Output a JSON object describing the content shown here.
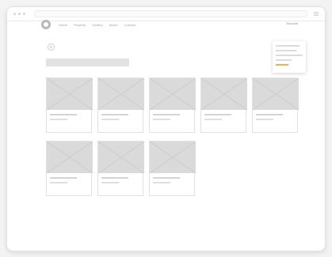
{
  "header": {
    "menu": [
      {
        "label": "Home"
      },
      {
        "label": "Projects"
      },
      {
        "label": "Gallery"
      },
      {
        "label": "About"
      },
      {
        "label": "Contact"
      }
    ],
    "account_label": "Account"
  },
  "page": {
    "cards": [
      {
        "id": 1
      },
      {
        "id": 2
      },
      {
        "id": 3
      },
      {
        "id": 4
      },
      {
        "id": 5
      },
      {
        "id": 6
      },
      {
        "id": 7
      },
      {
        "id": 8
      }
    ]
  },
  "dropdown": {
    "accent_color": "#f2b43a"
  },
  "icons": {
    "logo": "circle-logo-icon",
    "back": "chevron-left-icon",
    "menu": "hamburger-icon",
    "image_placeholder": "image-placeholder-icon"
  },
  "colors": {
    "window_bg": "#ffffff",
    "placeholder_gray": "#dadada"
  }
}
